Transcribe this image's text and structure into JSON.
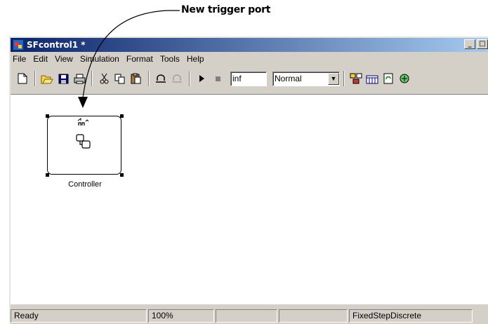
{
  "callout": {
    "label": "New trigger port"
  },
  "window": {
    "title": "SFcontrol1 *",
    "buttons": {
      "minimize": "_",
      "maximize": "□",
      "close": "×"
    }
  },
  "menu": [
    "File",
    "Edit",
    "View",
    "Simulation",
    "Format",
    "Tools",
    "Help"
  ],
  "toolbar": {
    "stop_time": "inf",
    "sim_mode": "Normal",
    "icons": [
      "new-file-icon",
      "open-folder-icon",
      "save-icon",
      "print-icon",
      "cut-icon",
      "copy-icon",
      "paste-icon",
      "undo-icon",
      "redo-icon",
      "play-icon",
      "stop-icon",
      "library-browser-icon",
      "model-explorer-icon",
      "update-diagram-icon",
      "debug-icon"
    ]
  },
  "block": {
    "label": "Controller"
  },
  "status": {
    "state": "Ready",
    "zoom": "100%",
    "solver": "FixedStepDiscrete"
  }
}
